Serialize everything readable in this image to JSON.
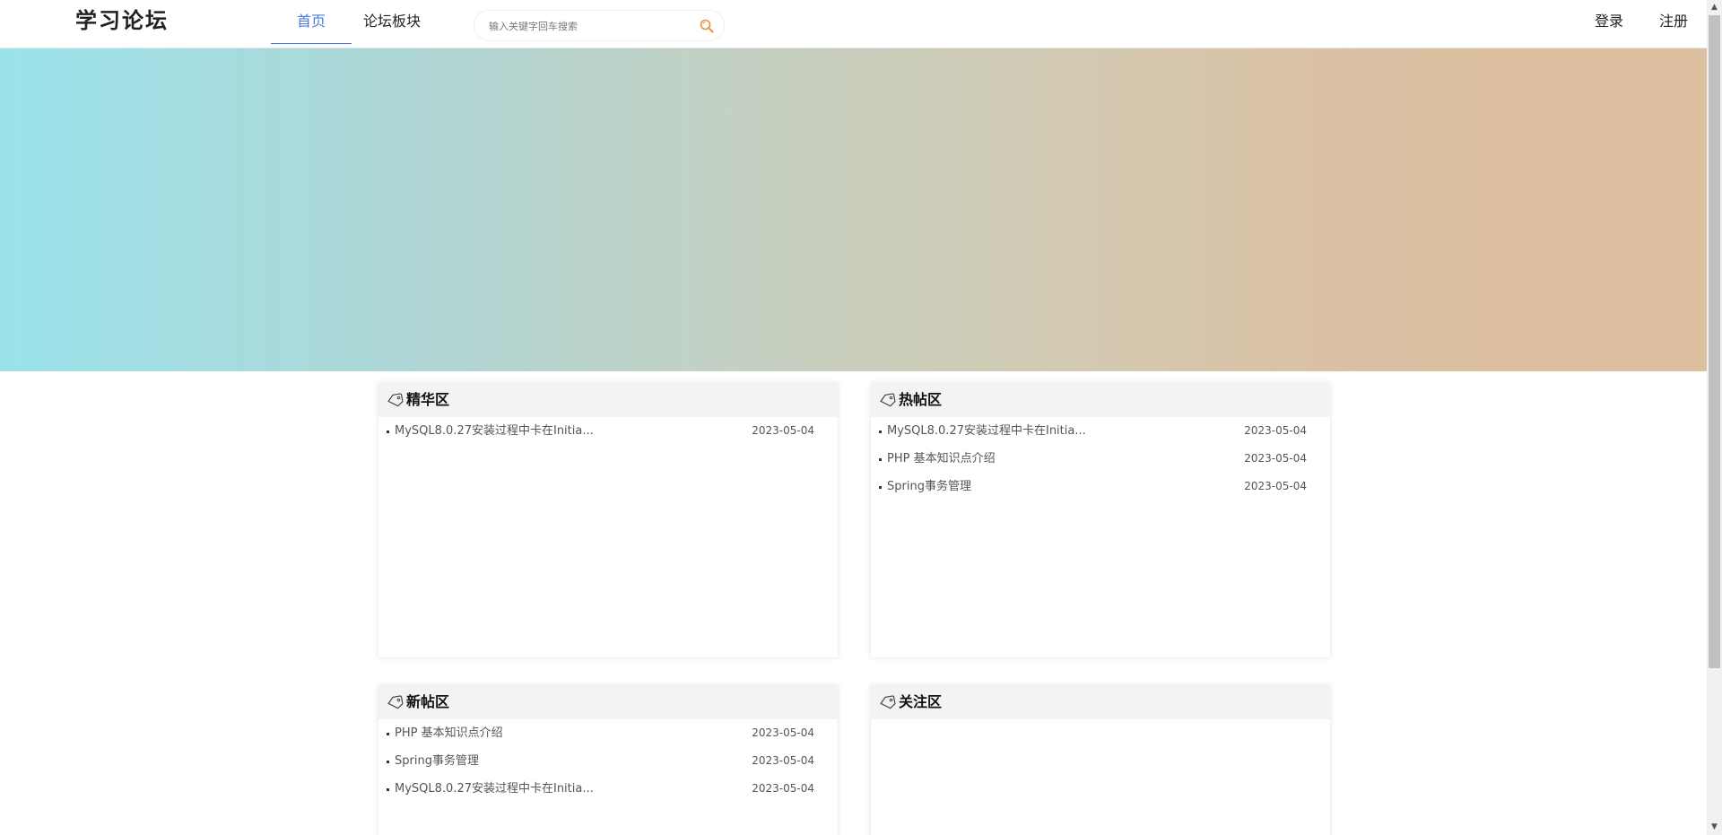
{
  "header": {
    "logo": "学习论坛",
    "nav": [
      {
        "label": "首页"
      },
      {
        "label": "论坛板块"
      }
    ],
    "search": {
      "placeholder": "输入关键字回车搜索",
      "value": ""
    },
    "login": "登录",
    "register": "注册"
  },
  "sections": {
    "featured": {
      "title": "精华区",
      "items": [
        {
          "title": "MySQL8.0.27安装过程中卡在Initia...",
          "date": "2023-05-04"
        }
      ]
    },
    "hot": {
      "title": "热帖区",
      "items": [
        {
          "title": "MySQL8.0.27安装过程中卡在Initia...",
          "date": "2023-05-04"
        },
        {
          "title": "PHP 基本知识点介绍",
          "date": "2023-05-04"
        },
        {
          "title": "Spring事务管理",
          "date": "2023-05-04"
        }
      ]
    },
    "new": {
      "title": "新帖区",
      "items": [
        {
          "title": "PHP 基本知识点介绍",
          "date": "2023-05-04"
        },
        {
          "title": "Spring事务管理",
          "date": "2023-05-04"
        },
        {
          "title": "MySQL8.0.27安装过程中卡在Initia...",
          "date": "2023-05-04"
        }
      ]
    },
    "follow": {
      "title": "关注区",
      "items": []
    }
  },
  "colors": {
    "accent": "#4a78e0",
    "banner_start": "#9ae2ea",
    "banner_end": "#dcbf9e"
  }
}
